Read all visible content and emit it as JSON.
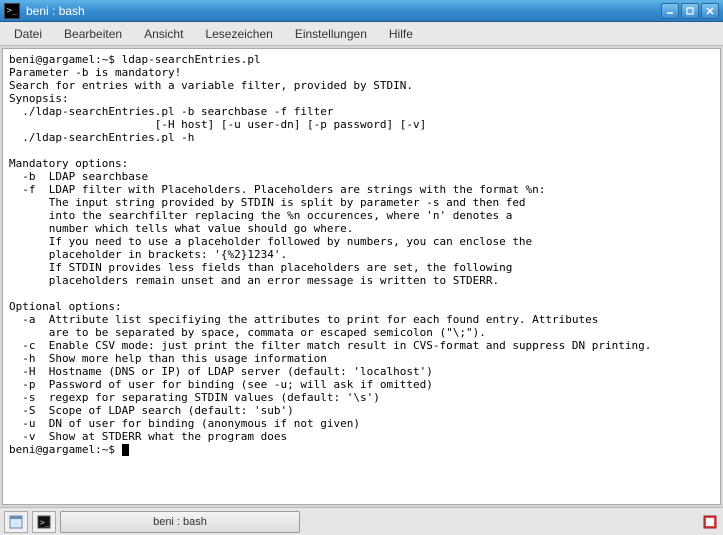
{
  "window": {
    "title": "beni : bash"
  },
  "menubar": {
    "items": [
      "Datei",
      "Bearbeiten",
      "Ansicht",
      "Lesezeichen",
      "Einstellungen",
      "Hilfe"
    ]
  },
  "terminal": {
    "prompt1": "beni@gargamel:~$ ",
    "command1": "ldap-searchEntries.pl",
    "output": "Parameter -b is mandatory!\nSearch for entries with a variable filter, provided by STDIN.\nSynopsis:\n  ./ldap-searchEntries.pl -b searchbase -f filter\n                      [-H host] [-u user-dn] [-p password] [-v]\n  ./ldap-searchEntries.pl -h\n\nMandatory options:\n  -b  LDAP searchbase\n  -f  LDAP filter with Placeholders. Placeholders are strings with the format %n:\n      The input string provided by STDIN is split by parameter -s and then fed\n      into the searchfilter replacing the %n occurences, where 'n' denotes a\n      number which tells what value should go where.\n      If you need to use a placeholder followed by numbers, you can enclose the\n      placeholder in brackets: '{%2}1234'.\n      If STDIN provides less fields than placeholders are set, the following\n      placeholders remain unset and an error message is written to STDERR.\n\nOptional options:\n  -a  Attribute list specifiying the attributes to print for each found entry. Attributes\n      are to be separated by space, commata or escaped semicolon (\"\\;\").\n  -c  Enable CSV mode: just print the filter match result in CVS-format and suppress DN printing.\n  -h  Show more help than this usage information\n  -H  Hostname (DNS or IP) of LDAP server (default: 'localhost')\n  -p  Password of user for binding (see -u; will ask if omitted)\n  -s  regexp for separating STDIN values (default: '\\s')\n  -S  Scope of LDAP search (default: 'sub')\n  -u  DN of user for binding (anonymous if not given)\n  -v  Show at STDERR what the program does",
    "prompt2": "beni@gargamel:~$ "
  },
  "taskbar": {
    "active_window": "beni : bash"
  }
}
